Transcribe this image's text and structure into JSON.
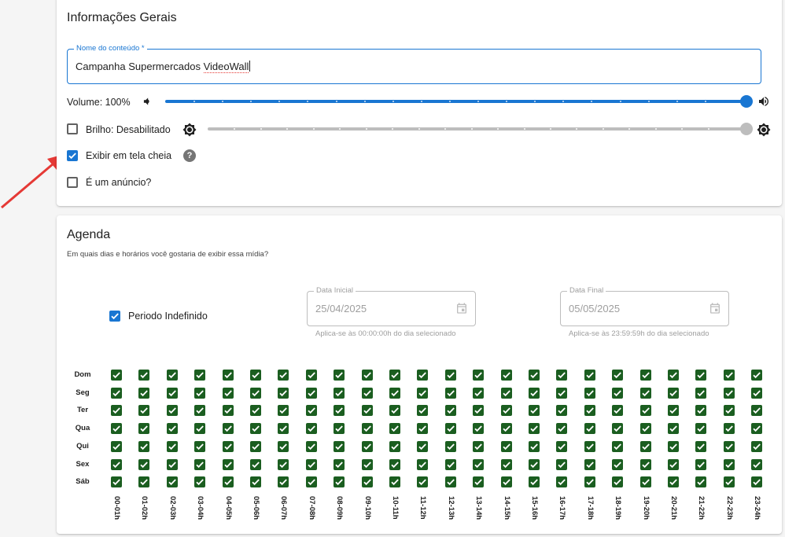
{
  "general": {
    "title": "Informações Gerais",
    "name_field": {
      "label": "Nome do conteúdo *",
      "value_prefix": "Campanha Supermercados ",
      "value_misspelled": "VideoWall"
    },
    "volume": {
      "label": "Volume: 100%",
      "value_percent": 100
    },
    "brightness": {
      "label": "Brilho: Desabilitado",
      "checked": false,
      "value_percent": 100
    },
    "fullscreen": {
      "label": "Exibir em tela cheia",
      "checked": true,
      "help": "?"
    },
    "ad": {
      "label": "É um anúncio?",
      "checked": false
    }
  },
  "agenda": {
    "title": "Agenda",
    "subtitle": "Em quais dias e horários você gostaria de exibir essa mídia?",
    "indefinite": {
      "label": "Periodo Indefinido",
      "checked": true
    },
    "start_date": {
      "label": "Data Inicial",
      "value": "25/04/2025",
      "helper": "Aplica-se às 00:00:00h do dia selecionado"
    },
    "end_date": {
      "label": "Data Final",
      "value": "05/05/2025",
      "helper": "Aplica-se às 23:59:59h do dia selecionado"
    },
    "days": [
      "Dom",
      "Seg",
      "Ter",
      "Qua",
      "Qui",
      "Sex",
      "Sáb"
    ],
    "hours": [
      "00-01h",
      "01-02h",
      "02-03h",
      "03-04h",
      "04-05h",
      "05-06h",
      "06-07h",
      "07-08h",
      "08-09h",
      "09-10h",
      "10-11h",
      "11-12h",
      "12-13h",
      "13-14h",
      "14-15h",
      "15-16h",
      "16-17h",
      "17-18h",
      "18-19h",
      "19-20h",
      "20-21h",
      "21-22h",
      "22-23h",
      "23-24h"
    ],
    "all_checked": true
  },
  "colors": {
    "primary": "#1976d2",
    "grid_check": "#1b5e20",
    "annotation_arrow": "#e53935",
    "disabled": "#bdbdbd"
  }
}
